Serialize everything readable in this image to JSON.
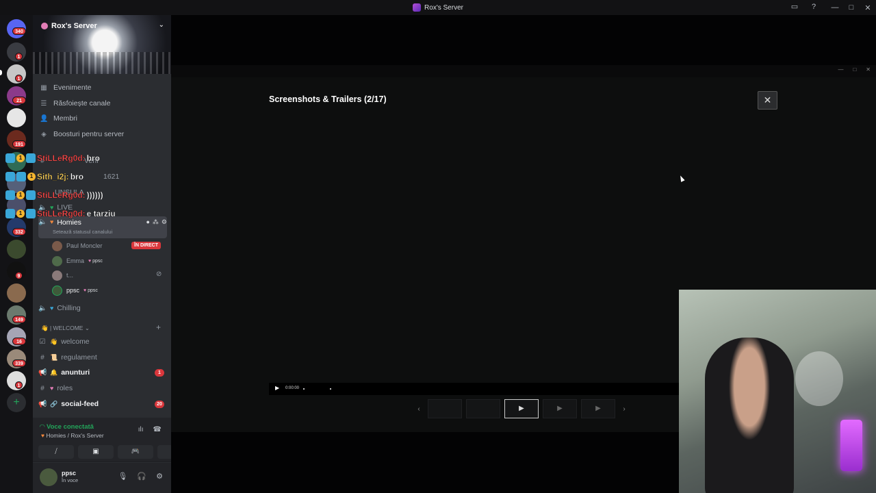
{
  "window": {
    "title": "Rox's Server",
    "controls": [
      "—",
      "□",
      "✕"
    ]
  },
  "server_rail": {
    "badges": [
      "340",
      "1",
      "1",
      "21",
      "191",
      "332",
      "9",
      "149",
      "16",
      "339",
      "1"
    ]
  },
  "sidebar": {
    "server_name": "Rox's Server",
    "nav": [
      {
        "icon": "calendar-icon",
        "label": "Evenimente"
      },
      {
        "icon": "browse-icon",
        "label": "Răsfoiește canale"
      },
      {
        "icon": "members-icon",
        "label": "Membri"
      },
      {
        "icon": "boost-icon",
        "label": "Boosturi pentru server"
      }
    ],
    "hidden_channels": [
      "Verif",
      "1621",
      "UNSULA",
      "LIVE"
    ],
    "active_channel": {
      "name": "Homies",
      "status_hint": "Setează statusul canalului"
    },
    "voice_users": [
      {
        "name": "Paul Moncler",
        "badge": "ÎN DIRECT"
      },
      {
        "name": "Emma",
        "tag": "ppsc"
      },
      {
        "name": "t..."
      },
      {
        "name": "ppsc",
        "tag": "ppsc"
      }
    ],
    "chilling": "Chilling",
    "category": "| WELCOME",
    "channels": [
      {
        "name": "welcome",
        "bold": false,
        "badge": ""
      },
      {
        "name": "regulament",
        "bold": false,
        "badge": ""
      },
      {
        "name": "anunturi",
        "bold": true,
        "badge": "1"
      },
      {
        "name": "roles",
        "bold": false,
        "badge": ""
      },
      {
        "name": "social-feed",
        "bold": true,
        "badge": "20"
      }
    ]
  },
  "overlay_chat": [
    {
      "user": "StiLLeRg0d:",
      "message": "bro"
    },
    {
      "user": "Sith_i2j:",
      "message": "bro"
    },
    {
      "user": "StiLLeRg0d:",
      "message": "))))))"
    },
    {
      "user": "StiLLeRg0d:",
      "message": "e tarziu"
    }
  ],
  "voice_panel": {
    "title": "Voce conectată",
    "subtitle": "Homies / Rox's Server"
  },
  "user_panel": {
    "name": "ppsc",
    "status": "În voce"
  },
  "modal": {
    "title": "Screenshots & Trailers (2/17)",
    "close_label": "✕",
    "time": "0:00:00",
    "prev_label": "‹",
    "next_label": "›"
  }
}
